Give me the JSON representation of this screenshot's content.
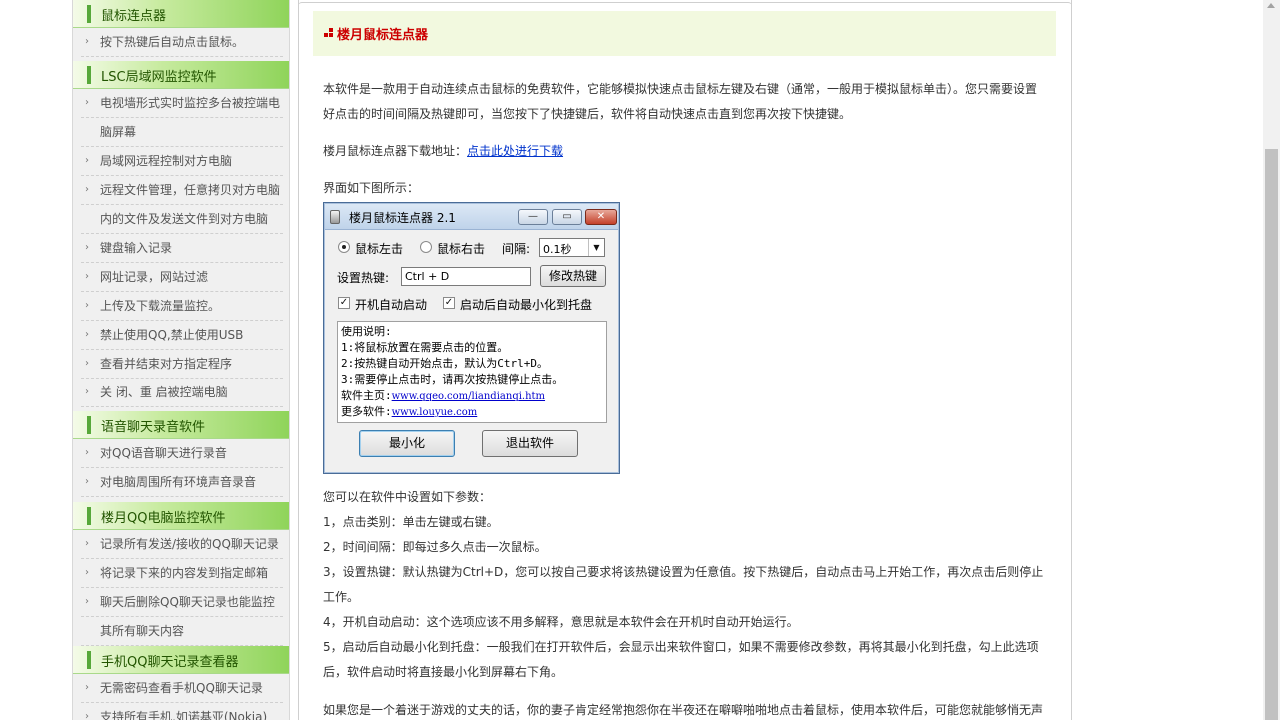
{
  "sidebar": {
    "sections": [
      {
        "title": "鼠标连点器",
        "items": [
          "按下热键后自动点击鼠标。"
        ]
      },
      {
        "title": "LSC局域网监控软件",
        "items": [
          "电视墙形式实时监控多台被控端电",
          "脑屏幕",
          "局域网远程控制对方电脑",
          "远程文件管理，任意拷贝对方电脑",
          "内的文件及发送文件到对方电脑",
          "键盘输入记录",
          "网址记录，网站过滤",
          "上传及下载流量监控。",
          "禁止使用QQ,禁止使用USB",
          "查看并结束对方指定程序",
          "关 闭、重 启被控端电脑"
        ]
      },
      {
        "title": "语音聊天录音软件",
        "items": [
          "对QQ语音聊天进行录音",
          "对电脑周围所有环境声音录音"
        ]
      },
      {
        "title": "楼月QQ电脑监控软件",
        "items": [
          "记录所有发送/接收的QQ聊天记录",
          "将记录下来的内容发到指定邮箱",
          "聊天后删除QQ聊天记录也能监控",
          "其所有聊天内容"
        ]
      },
      {
        "title": "手机QQ聊天记录查看器",
        "items": [
          "无需密码查看手机QQ聊天记录",
          "支持所有手机,如诺基亚(Nokia)"
        ]
      }
    ]
  },
  "main": {
    "title": "楼月鼠标连点器",
    "intro_line1": "本软件是一款用于自动连续点击鼠标的免费软件，它能够模拟快速点击鼠标左键及右键（通常，一般用于模拟鼠标单击）。您只需要设置",
    "intro_line2": "好点击的时间间隔及热键即可，当您按下了快捷键后，软件将自动快速点击直到您再次按下快捷键。",
    "download_label": "楼月鼠标连点器下载地址：",
    "download_link": "点击此处进行下载",
    "ui_label": "界面如下图所示：",
    "params_intro": "您可以在软件中设置如下参数：",
    "param1": "1，点击类别：单击左键或右键。",
    "param2": "2，时间间隔：即每过多久点击一次鼠标。",
    "param3_line1": "3，设置热键：默认热键为Ctrl+D，您可以按自己要求将该热键设置为任意值。按下热键后，自动点击马上开始工作，再次点击后则停止",
    "param3_line2": "工作。",
    "param4": "4，开机自动启动：这个选项应该不用多解释，意思就是本软件会在开机时自动开始运行。",
    "param5_line1": "5，启动后自动最小化到托盘：一般我们在打开软件后，会显示出来软件窗口，如果不需要修改参数，再将其最小化到托盘，勾上此选项",
    "param5_line2": "后，软件启动时将直接最小化到屏幕右下角。",
    "last_para": "如果您是一个着迷于游戏的丈夫的话，你的妻子肯定经常抱怨你在半夜还在噼噼啪啪地点击着鼠标，使用本软件后，可能您就能够悄无声"
  },
  "app": {
    "title": "楼月鼠标连点器 2.1",
    "radio_left": "鼠标左击",
    "radio_right": "鼠标右击",
    "interval_label": "间隔:",
    "interval_value": "0.1秒",
    "hotkey_label": "设置热键:",
    "hotkey_value": "Ctrl + D",
    "modify_button": "修改热键",
    "chk_autostart": "开机自动启动",
    "chk_minimize": "启动后自动最小化到托盘",
    "instr_title": "使用说明:",
    "instr1": "1:将鼠标放置在需要点击的位置。",
    "instr2": "2:按热键自动开始点击，默认为Ctrl+D。",
    "instr3": "3:需要停止点击时，请再次按热键停止点击。",
    "homepage_label": "软件主页:",
    "homepage_url": "www.qqeo.com/liandianqi.htm",
    "more_label": "更多软件:",
    "more_url": "www.louyue.com",
    "minimize_button": "最小化",
    "exit_button": "退出软件",
    "radio_left_checked": true,
    "autostart_checked": true,
    "minimize_checked": true
  },
  "colors": {
    "title_red": "#cc0000",
    "link_blue": "#0033cc",
    "sidebar_green": "#8fd45a"
  }
}
